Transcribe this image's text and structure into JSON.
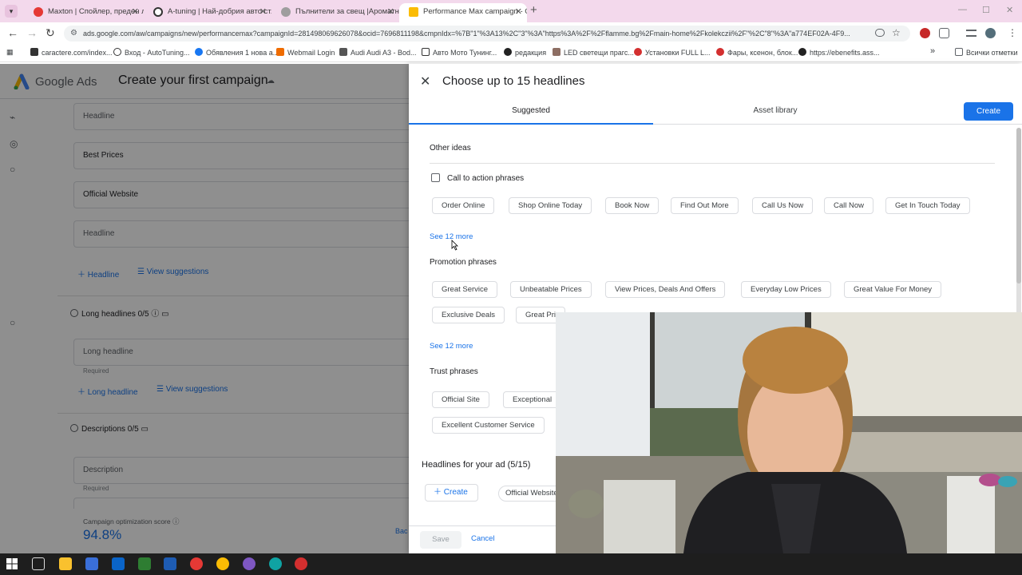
{
  "browser": {
    "tabs": [
      {
        "title": "Maxton | Спойлер, преден ли..."
      },
      {
        "title": "A-tuning | Най-добрия авто ст..."
      },
      {
        "title": "Пълнители за свещ |Ароматни..."
      },
      {
        "title": "Performance Max campaign - G..."
      }
    ],
    "new_tab_symbol": "+",
    "url": "ads.google.com/aw/campaigns/new/performancemax?campaignId=281498069626078&ocid=7696811198&cmpnIdx=%7B\"1\"%3A13%2C\"3\"%3A\"https%3A%2F%2Fflamme.bg%2Fmain-home%2Fkolekczii%2F\"%2C\"8\"%3A\"a774EF02A-4F9...",
    "bookmarks": [
      "caractere.com/index...",
      "Вход - AutoTuning...",
      "Обявления 1 нова а...",
      "Webmail Login",
      "Audi Audi A3 - Bod...",
      "Авто Мото Тунинг...",
      "редакция",
      "LED светещи прагс...",
      "Установки FULL L...",
      "Фары, ксенон, блок...",
      "https://ebenefits.ass..."
    ],
    "bookmarks_more": "»",
    "all_bookmarks": "Всички отметки"
  },
  "ads": {
    "brand": "Google Ads",
    "page_title": "Create your first campaign",
    "headline_fields": [
      "Headline",
      "Best Prices",
      "Official Website",
      "Headline"
    ],
    "add_headline": "Headline",
    "view_suggestions": "View suggestions",
    "long_headlines_label": "Long headlines 0/5",
    "long_headline_placeholder": "Long headline",
    "required": "Required",
    "add_long_headline": "Long headline",
    "descriptions_label": "Descriptions 0/5",
    "description_placeholder": "Description",
    "score_label": "Campaign optimization score",
    "score_value": "94.8%",
    "back_label": "Bac"
  },
  "panel": {
    "title": "Choose up to 15 headlines",
    "tabs": [
      {
        "label": "Suggested"
      },
      {
        "label": "Asset library"
      }
    ],
    "create_label": "Create",
    "other_ideas": "Other ideas",
    "call_to_action": {
      "label": "Call to action phrases",
      "chips": [
        "Order Online",
        "Shop Online Today",
        "Book Now",
        "Find Out More",
        "Call Us Now",
        "Call Now",
        "Get In Touch Today"
      ],
      "see_more": "See 12 more"
    },
    "promotion": {
      "label": "Promotion phrases",
      "chips": [
        "Great Service",
        "Unbeatable Prices",
        "View Prices, Deals And Offers",
        "Everyday Low Prices",
        "Great Value For Money",
        "Exclusive Deals",
        "Great Pri"
      ],
      "see_more": "See 12 more"
    },
    "trust": {
      "label": "Trust phrases",
      "chips": [
        "Official Site",
        "Exceptional",
        "Excellent Customer Service"
      ]
    },
    "footer_title": "Headlines for your ad (5/15)",
    "footer_create": "Create",
    "footer_chip": "Official Website",
    "save_label": "Save",
    "cancel_label": "Cancel"
  },
  "colors": {
    "accent": "#1a73e8",
    "tabbar": "#f3d9ec"
  }
}
